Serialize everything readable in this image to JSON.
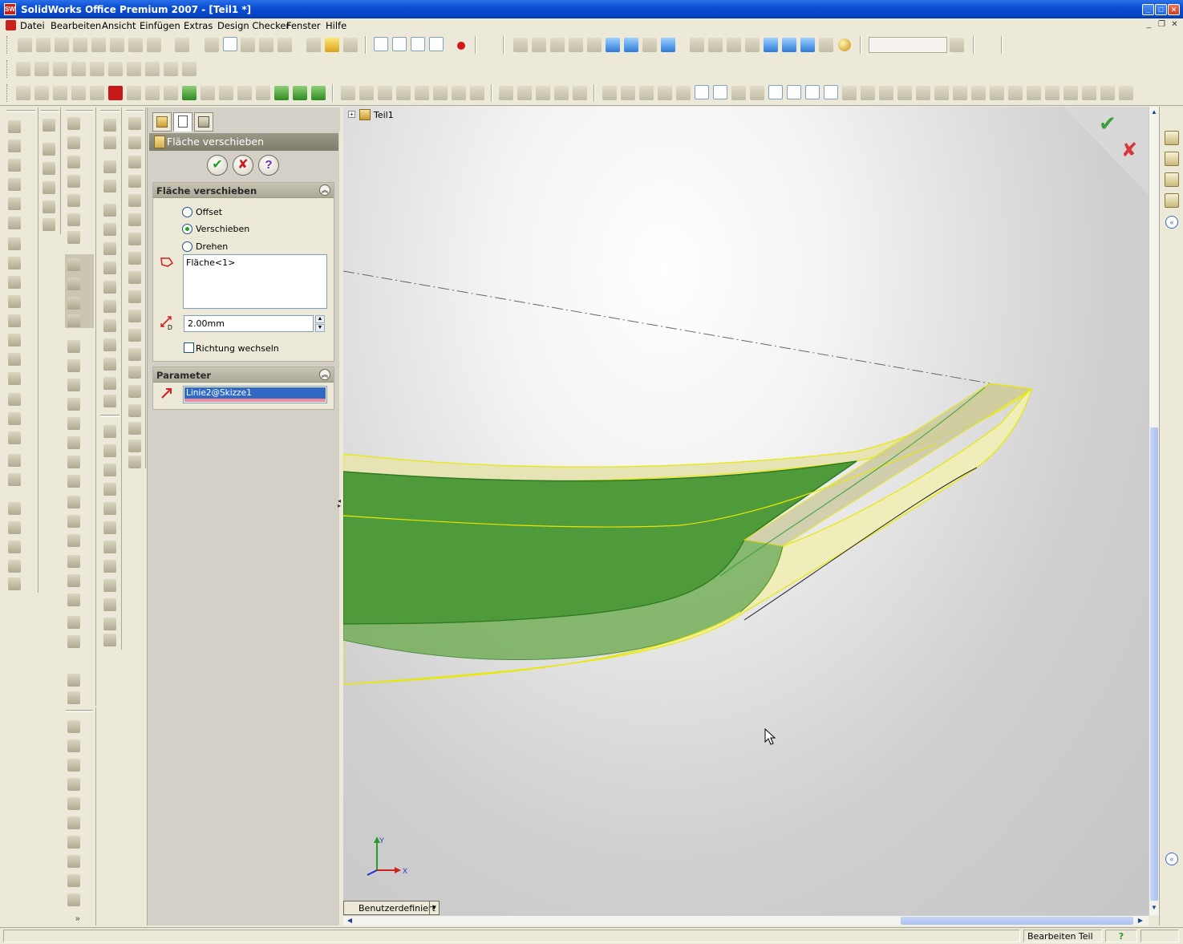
{
  "window": {
    "title": "SolidWorks Office Premium 2007 - [Teil1 *]",
    "app_icon_label": "SW",
    "controls": [
      "minimize-icon",
      "maximize-icon",
      "close-icon"
    ]
  },
  "menu": {
    "items": [
      "Datei",
      "Bearbeiten",
      "Ansicht",
      "Einfügen",
      "Extras",
      "Design Checker",
      "Fenster",
      "Hilfe"
    ]
  },
  "property_manager": {
    "title": "Fläche verschieben",
    "ok_glyph": "✔",
    "cancel_glyph": "✘",
    "help_glyph": "?",
    "group_move": {
      "title": "Fläche verschieben",
      "options": [
        {
          "label": "Offset",
          "checked": false
        },
        {
          "label": "Verschieben",
          "checked": true
        },
        {
          "label": "Drehen",
          "checked": false
        }
      ],
      "faces_list": [
        "Fläche<1>"
      ],
      "distance_value": "2.00mm",
      "reverse_direction_label": "Richtung wechseln",
      "reverse_direction_checked": false
    },
    "group_parameter": {
      "title": "Parameter",
      "direction_reference": "Linie2@Skizze1"
    }
  },
  "graphics": {
    "tree_root_label": "Teil1",
    "view_orientation": "Benutzerdefiniert",
    "triad_labels": {
      "x": "X",
      "y": "Y"
    },
    "confirm_glyph": "✔",
    "cancel_glyph": "✘",
    "highlight_color": "#f0f000",
    "selected_face_color": "#4f9a3a"
  },
  "status_bar": {
    "mode": "Bearbeiten Teil",
    "help_glyph": "?"
  }
}
